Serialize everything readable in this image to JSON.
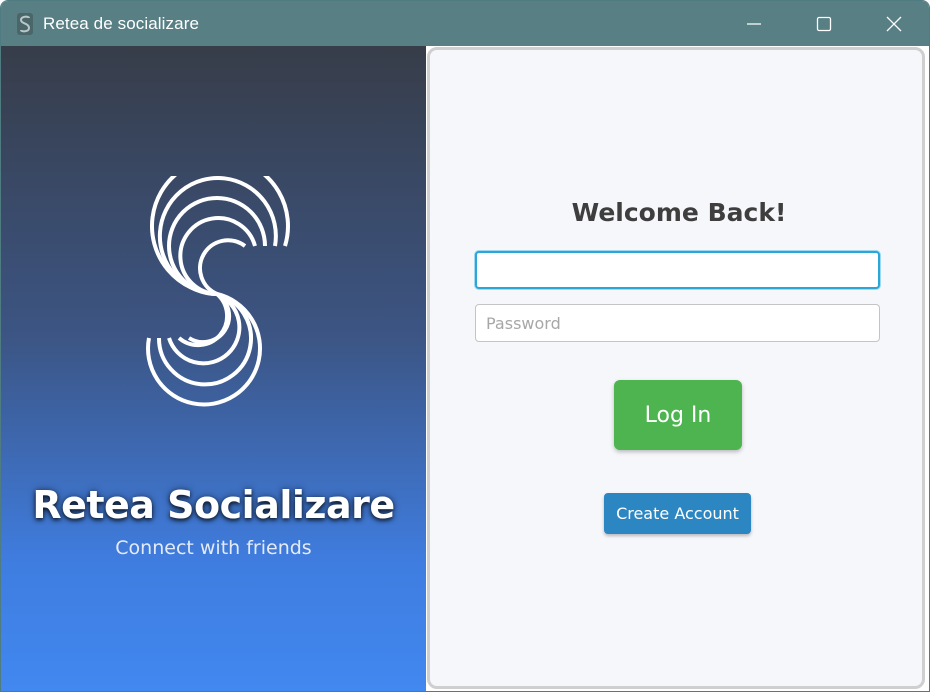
{
  "window": {
    "title": "Retea de socializare",
    "icon": "app-logo-icon",
    "controls": [
      "minimize-icon",
      "maximize-icon",
      "close-icon"
    ],
    "titlebar_color": "#577f84"
  },
  "left_panel": {
    "logo_icon": "s-logo-icon",
    "brand_title": "Retea Socializare",
    "brand_subtitle": "Connect with friends",
    "gradient": [
      "#373d49",
      "#4188f0"
    ]
  },
  "login_form": {
    "heading": "Welcome Back!",
    "username": {
      "value": "",
      "placeholder": ""
    },
    "password": {
      "value": "",
      "placeholder": "Password"
    },
    "login_label": "Log In",
    "create_account_label": "Create Account",
    "colors": {
      "login_button": "#4db450",
      "create_account_button": "#2b86c2",
      "focus_border": "#2aa7d8"
    }
  }
}
